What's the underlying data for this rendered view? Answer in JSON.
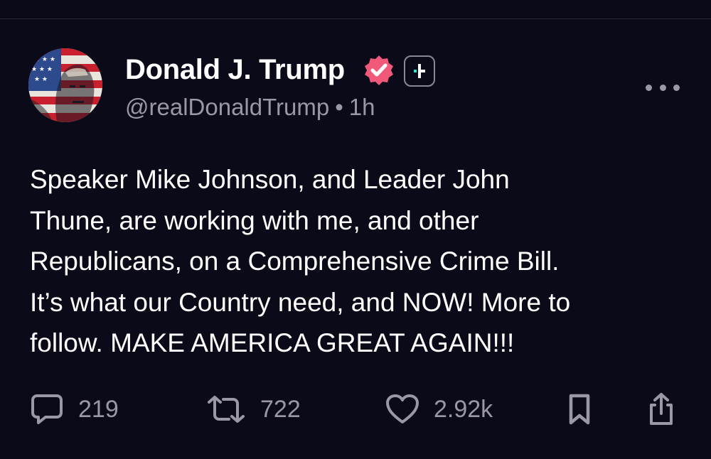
{
  "post": {
    "author": {
      "display_name": "Donald J. Trump",
      "handle": "@realDonaldTrump",
      "separator": "•",
      "time": "1h",
      "verified_color": "#f0597a",
      "avatar_icon": "flag-portrait-avatar"
    },
    "text_lines": [
      "Speaker Mike Johnson, and Leader John",
      "Thune, are working with me, and other",
      "Republicans, on a Comprehensive Crime Bill.",
      "It’s what our Country need, and NOW! More to",
      "follow. MAKE AMERICA GREAT AGAIN!!!"
    ],
    "actions": {
      "replies": "219",
      "reposts": "722",
      "likes": "2.92k"
    }
  },
  "colors": {
    "background": "#0b0a18",
    "text": "#ffffff",
    "muted": "#9a98a6",
    "plus_accent": "#2ee6c8"
  }
}
